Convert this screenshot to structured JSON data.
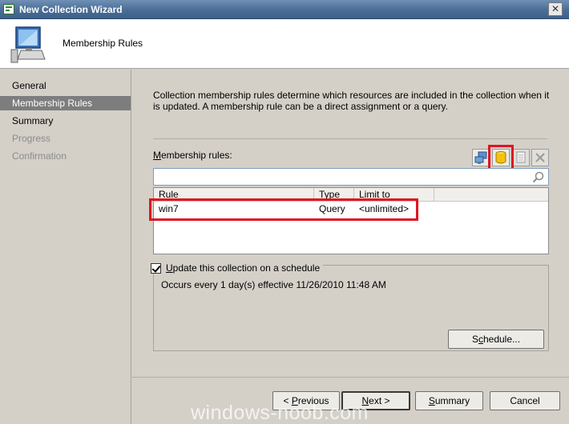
{
  "window": {
    "title": "New Collection Wizard",
    "close_label": "✕"
  },
  "header": {
    "title": "Membership Rules"
  },
  "sidebar": {
    "items": [
      {
        "label": "General",
        "state": "normal"
      },
      {
        "label": "Membership Rules",
        "state": "active"
      },
      {
        "label": "Summary",
        "state": "normal"
      },
      {
        "label": "Progress",
        "state": "disabled"
      },
      {
        "label": "Confirmation",
        "state": "disabled"
      }
    ]
  },
  "main": {
    "description": "Collection membership rules determine which resources are included in the collection when it is updated. A membership rule can be a direct assignment or a query.",
    "rules_label_prefix": "",
    "rules_label_key": "M",
    "rules_label_rest": "embership rules:",
    "filter": {
      "value": "",
      "placeholder": ""
    },
    "columns": [
      "Rule",
      "Type",
      "Limit to"
    ],
    "rows": [
      {
        "rule": "win7",
        "type": "Query",
        "limit": "<unlimited>"
      }
    ],
    "schedule": {
      "checked": true,
      "label_key": "U",
      "label_rest": "pdate this collection on a schedule",
      "text": "Occurs every 1 day(s) effective 11/26/2010 11:48 AM",
      "button_label_a": "S",
      "button_label_key": "c",
      "button_label_b": "hedule..."
    },
    "toolbar_icons": [
      "add-direct-rule-icon",
      "add-query-rule-icon",
      "properties-icon",
      "delete-icon"
    ]
  },
  "footer": {
    "previous": {
      "pre": "< ",
      "key": "P",
      "rest": "revious"
    },
    "next": {
      "key": "N",
      "rest": "ext >"
    },
    "summary": {
      "key": "S",
      "rest": "ummary"
    },
    "cancel": "Cancel"
  },
  "watermark": "windows-noob.com",
  "colors": {
    "highlight": "#e0141f",
    "active_sidebar": "#7d7d7d",
    "titlebar": "#4a6d97"
  }
}
